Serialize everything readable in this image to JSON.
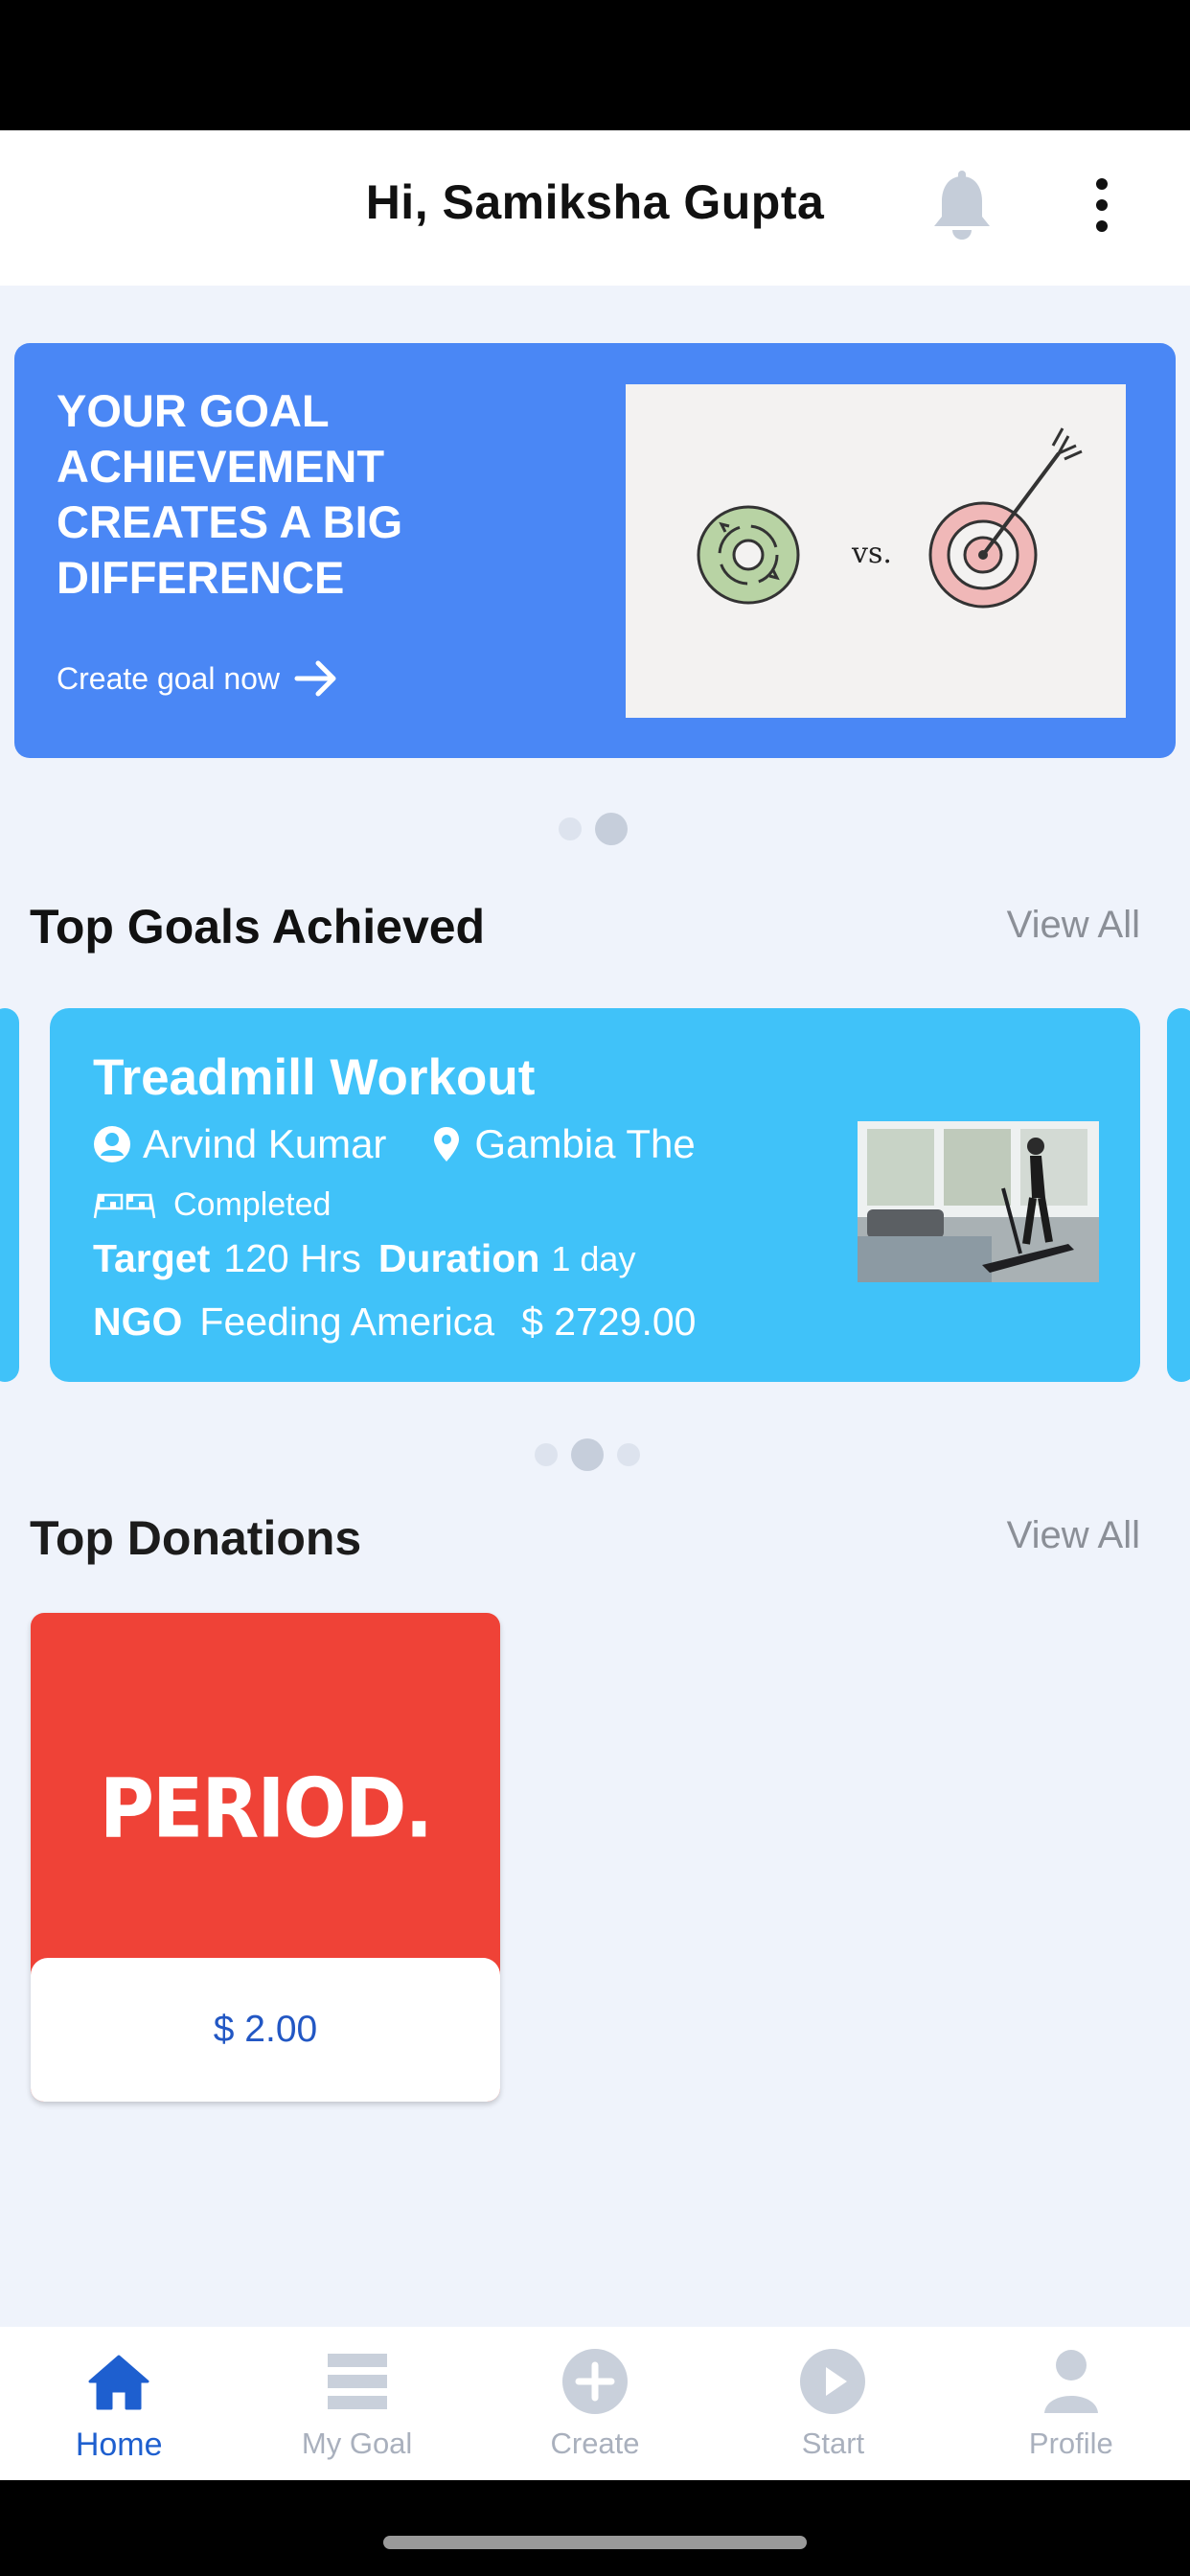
{
  "header": {
    "greeting": "Hi, Samiksha Gupta"
  },
  "banner": {
    "title": "YOUR GOAL ACHIEVEMENT CREATES A BIG DIFFERENCE",
    "cta": "Create goal now",
    "illustration_text": "vs.",
    "carousel_active_index": 1,
    "carousel_count": 2
  },
  "top_goals": {
    "title": "Top Goals Achieved",
    "view_all": "View All",
    "carousel_active_index": 1,
    "carousel_count": 3,
    "card": {
      "title": "Treadmill Workout",
      "user": "Arvind Kumar",
      "location": "Gambia The",
      "status": "Completed",
      "target_label": "Target",
      "target_value": "120 Hrs",
      "duration_label": "Duration",
      "duration_value": "1 day",
      "ngo_label": "NGO",
      "ngo_value": "Feeding America",
      "amount": "$ 2729.00"
    }
  },
  "top_donations": {
    "title": "Top Donations",
    "view_all": "View All",
    "items": [
      {
        "logo_text": "PERIOD.",
        "amount": "$ 2.00"
      }
    ]
  },
  "tab_bar": {
    "active": "home",
    "items": [
      {
        "id": "home",
        "label": "Home",
        "icon": "home-icon"
      },
      {
        "id": "my-goal",
        "label": "My Goal",
        "icon": "list-icon"
      },
      {
        "id": "create",
        "label": "Create",
        "icon": "plus-circle-icon"
      },
      {
        "id": "start",
        "label": "Start",
        "icon": "play-circle-icon"
      },
      {
        "id": "profile",
        "label": "Profile",
        "icon": "person-icon"
      }
    ]
  },
  "colors": {
    "banner_bg": "#4a87f5",
    "goal_card_bg": "#40c2f9",
    "donation_card_bg": "#ef4237",
    "active_tab": "#1e5fcf",
    "inactive_tab": "#a9b0bd",
    "page_bg": "#eff3fb"
  }
}
